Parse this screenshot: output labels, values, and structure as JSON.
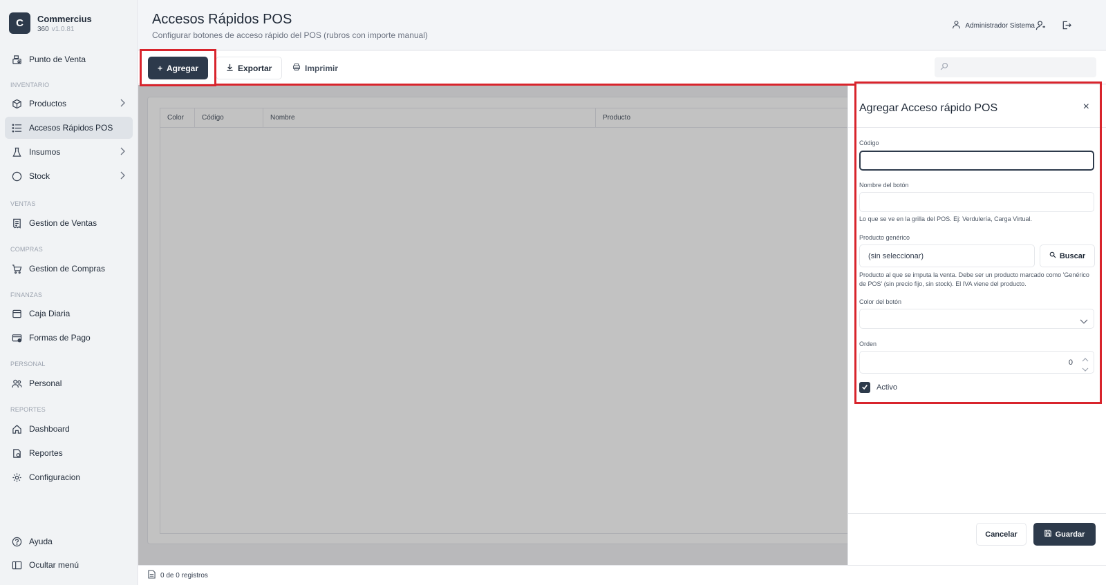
{
  "brand": {
    "logo_letter": "C",
    "name": "Commercius",
    "sub": "360",
    "version": "v1.0.81"
  },
  "sidebar": {
    "pos": "Punto de Venta",
    "sections": [
      "INVENTARIO",
      "VENTAS",
      "COMPRAS",
      "FINANZAS",
      "PERSONAL",
      "REPORTES"
    ],
    "items": {
      "productos": "Productos",
      "accesos": "Accesos Rápidos POS",
      "insumos": "Insumos",
      "stock": "Stock",
      "ventas": "Gestion de Ventas",
      "compras": "Gestion de Compras",
      "caja": "Caja Diaria",
      "formas": "Formas de Pago",
      "personal": "Personal",
      "dashboard": "Dashboard",
      "reportes": "Reportes",
      "config": "Configuracion",
      "ayuda": "Ayuda",
      "ocultar": "Ocultar menú"
    }
  },
  "header": {
    "title": "Accesos Rápidos POS",
    "subtitle": "Configurar botones de acceso rápido del POS (rubros con importe manual)",
    "user": "Administrador Sistema"
  },
  "toolbar": {
    "add": "Agregar",
    "export": "Exportar",
    "print": "Imprimir"
  },
  "grid": {
    "columns": [
      "Color",
      "Código",
      "Nombre",
      "Producto"
    ]
  },
  "footer": {
    "records": "0 de 0 registros"
  },
  "drawer": {
    "title": "Agregar Acceso rápido POS",
    "close": "×",
    "codigo_label": "Código",
    "codigo_value": "",
    "nombre_label": "Nombre del botón",
    "nombre_value": "",
    "nombre_hint": "Lo que se ve en la grilla del POS. Ej: Verdulería, Carga Virtual.",
    "producto_label": "Producto genérico",
    "producto_value": "(sin seleccionar)",
    "buscar": "Buscar",
    "producto_hint": "Producto al que se imputa la venta. Debe ser un producto marcado como 'Genérico de POS' (sin precio fijo, sin stock). El IVA viene del producto.",
    "color_label": "Color del botón",
    "orden_label": "Orden",
    "orden_value": "0",
    "activo_label": "Activo",
    "activo_checked": true,
    "cancel": "Cancelar",
    "save": "Guardar"
  },
  "colors": {
    "primary": "#2d3a4b",
    "highlight": "#d8242c",
    "overlay": "rgba(0,0,0,0.24)"
  }
}
